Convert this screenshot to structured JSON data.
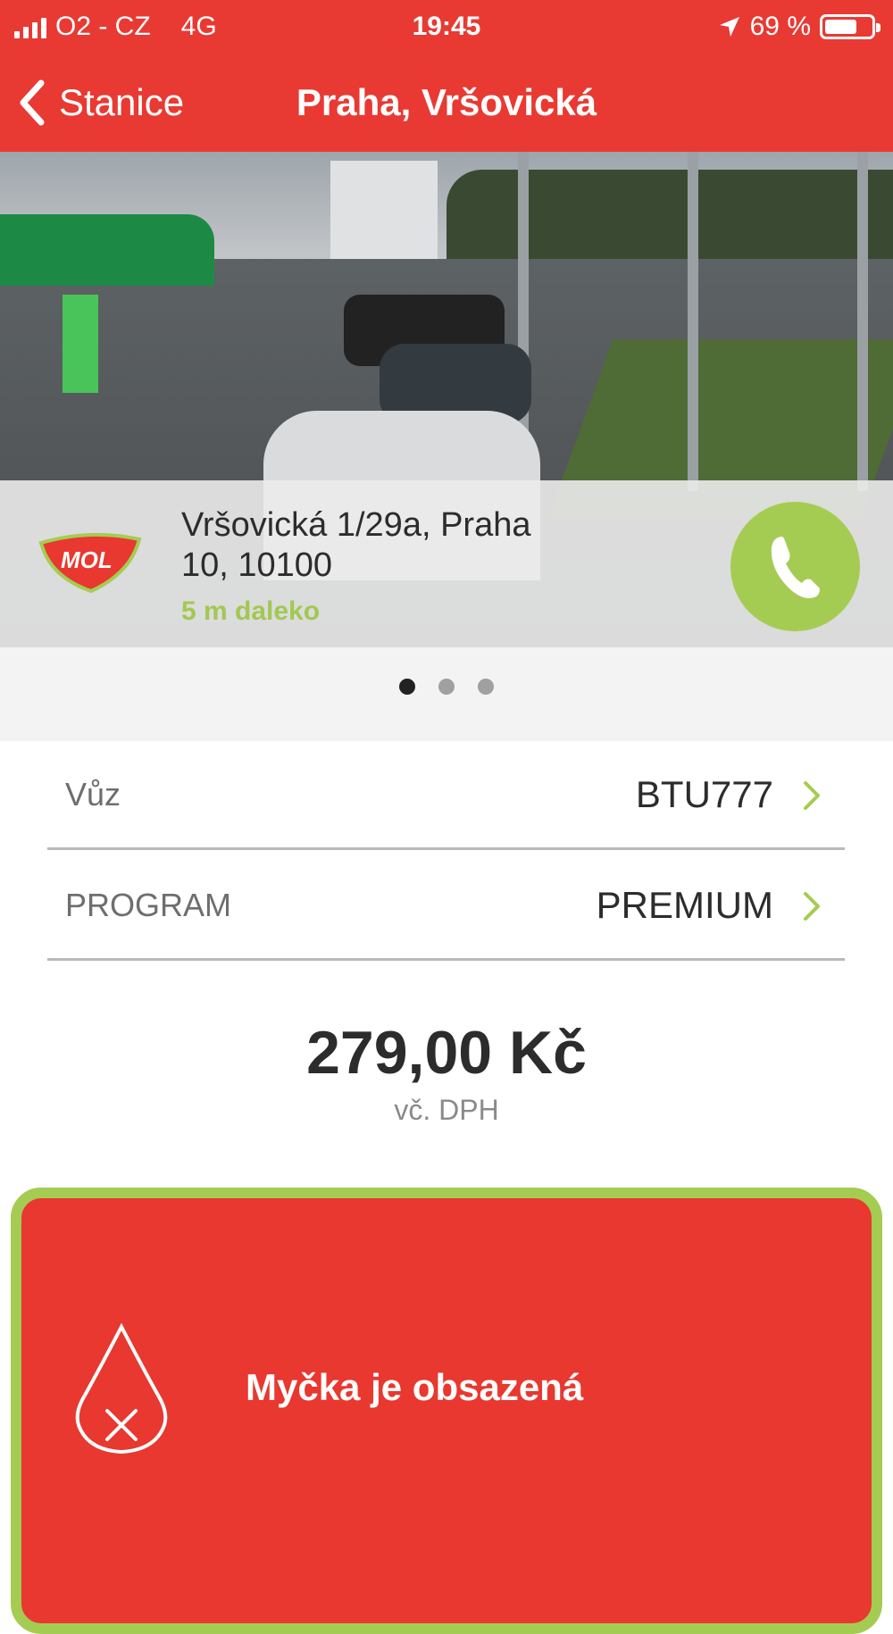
{
  "status_bar": {
    "carrier": "O2 - CZ",
    "network": "4G",
    "time": "19:45",
    "battery": "69 %",
    "battery_level": 0.69
  },
  "nav": {
    "back_label": "Stanice",
    "title": "Praha, Vršovická"
  },
  "station": {
    "brand": "MOL",
    "address_line1": "Vršovická 1/29a, Praha",
    "address_line2": "10, 10100",
    "distance": "5 m daleko"
  },
  "carousel": {
    "pages": 3,
    "active_index": 0
  },
  "rows": [
    {
      "label": "Vůz",
      "value": "BTU777"
    },
    {
      "label": "PROGRAM",
      "value": "PREMIUM"
    }
  ],
  "price": {
    "amount": "279,00 Kč",
    "note": "vč. DPH"
  },
  "alert": {
    "message": "Myčka je obsazená"
  },
  "colors": {
    "brand_red": "#e83a33",
    "accent_green": "#a5cc52"
  }
}
